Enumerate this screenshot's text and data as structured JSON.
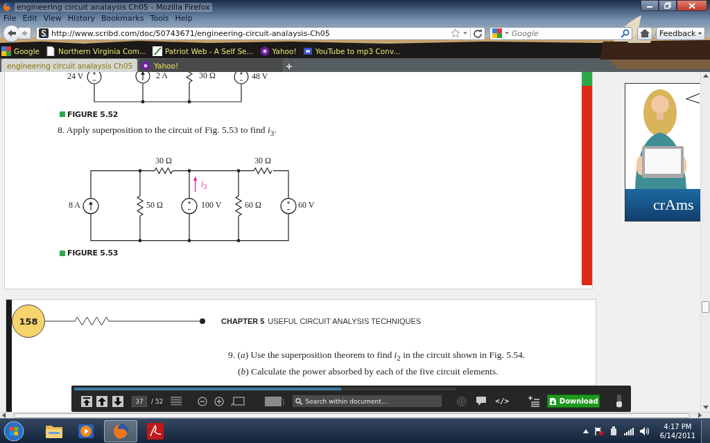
{
  "window": {
    "title": "engineering circuit analaysis Ch05 - Mozilla Firefox"
  },
  "menu": [
    "File",
    "Edit",
    "View",
    "History",
    "Bookmarks",
    "Tools",
    "Help"
  ],
  "navigation": {
    "url": "http://www.scribd.com/doc/50743671/engineering-circuit-analaysis-Ch05",
    "search_placeholder": "Google",
    "feedback": "Feedback"
  },
  "bookmarks": [
    {
      "label": "Google",
      "kind": "google"
    },
    {
      "label": "Northern Virginia Com...",
      "kind": "page"
    },
    {
      "label": "Patriot Web - A Self Se...",
      "kind": "patriot"
    },
    {
      "label": "Yahoo!",
      "kind": "yahoo"
    },
    {
      "label": "YouTube to mp3 Conv...",
      "kind": "youtube"
    }
  ],
  "tabs": [
    {
      "label": "engineering circuit analaysis Ch05",
      "kind": "scribd",
      "selected": true
    },
    {
      "label": "Yahoo!",
      "kind": "yahoo",
      "selected": false
    }
  ],
  "document": {
    "page_1": {
      "figure_5_52": {
        "labels": [
          "24 V",
          "2 A",
          "30 Ω",
          "48 V"
        ],
        "caption": "FIGURE 5.52"
      },
      "problem": "8. Apply superposition to the circuit of Fig. 5.53 to find *i*$_{3}$.",
      "figure_5_53": {
        "labels": [
          "30 Ω",
          "30 Ω",
          "*i*$_{3}$",
          "8 A",
          "50 Ω",
          "100 V",
          "60 Ω",
          "60 V"
        ],
        "caption": "FIGURE 5.53"
      }
    },
    "page_2": {
      "page_number": "158",
      "chapter": "CHAPTER 5",
      "chapter_title": "USEFUL CIRCUIT ANALYSIS TECHNIQUES",
      "problem_lines": [
        "9. (*a*) Use the superposition theorem to find *i*$_{2}$ in the circuit shown in Fig. 5.54.",
        "(*b*) Calculate the power absorbed by each of the five circuit elements."
      ]
    }
  },
  "ad": {
    "brand": "crAms"
  },
  "viewer_toolbar": {
    "page": "37",
    "page_count": "/ 52",
    "search_placeholder": "Search within document...",
    "embed": "</>",
    "download": "Download",
    "progress": {
      "level": 0.7
    }
  },
  "taskbar": {
    "apps": [
      {
        "kind": "explorer",
        "selected": false
      },
      {
        "kind": "media",
        "selected": false
      },
      {
        "kind": "firefox",
        "selected": true
      },
      {
        "kind": "acrobat",
        "selected": false
      }
    ],
    "time": "4:17 PM",
    "date": "6/14/2011"
  }
}
